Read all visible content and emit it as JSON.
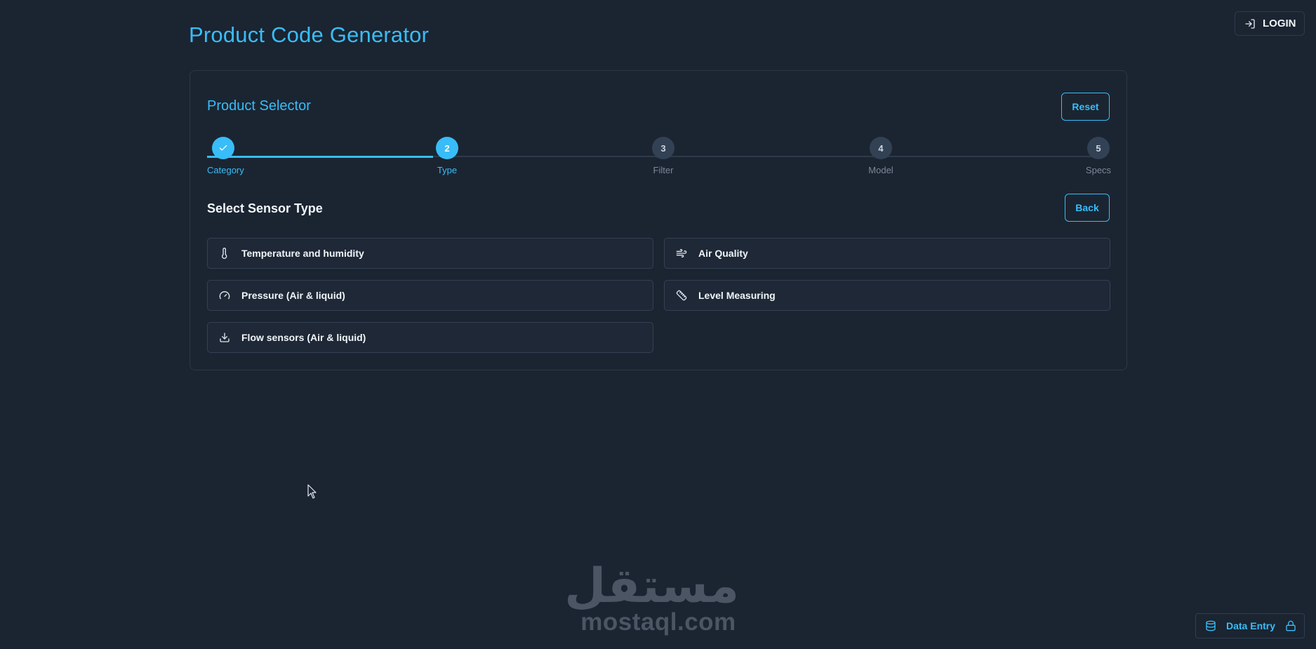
{
  "header": {
    "title": "Product Code Generator",
    "login_label": "LOGIN"
  },
  "selector": {
    "title": "Product Selector",
    "reset_label": "Reset",
    "back_label": "Back",
    "section_title": "Select Sensor Type",
    "steps": [
      {
        "number": "",
        "label": "Category",
        "state": "done"
      },
      {
        "number": "2",
        "label": "Type",
        "state": "active"
      },
      {
        "number": "3",
        "label": "Filter",
        "state": "pending"
      },
      {
        "number": "4",
        "label": "Model",
        "state": "pending"
      },
      {
        "number": "5",
        "label": "Specs",
        "state": "pending"
      }
    ],
    "options": [
      {
        "label": "Temperature and humidity",
        "icon": "thermometer-icon"
      },
      {
        "label": "Air Quality",
        "icon": "wind-icon"
      },
      {
        "label": "Pressure (Air & liquid)",
        "icon": "gauge-icon"
      },
      {
        "label": "Level Measuring",
        "icon": "ruler-icon"
      },
      {
        "label": "Flow sensors (Air & liquid)",
        "icon": "download-icon"
      }
    ]
  },
  "footer": {
    "data_entry_label": "Data Entry",
    "watermark_arabic": "مستقل",
    "watermark_text": "mostaql.com"
  },
  "colors": {
    "background": "#1b2431",
    "accent": "#38bdf8",
    "card_border": "#2c3746",
    "pending_step": "#334155"
  }
}
